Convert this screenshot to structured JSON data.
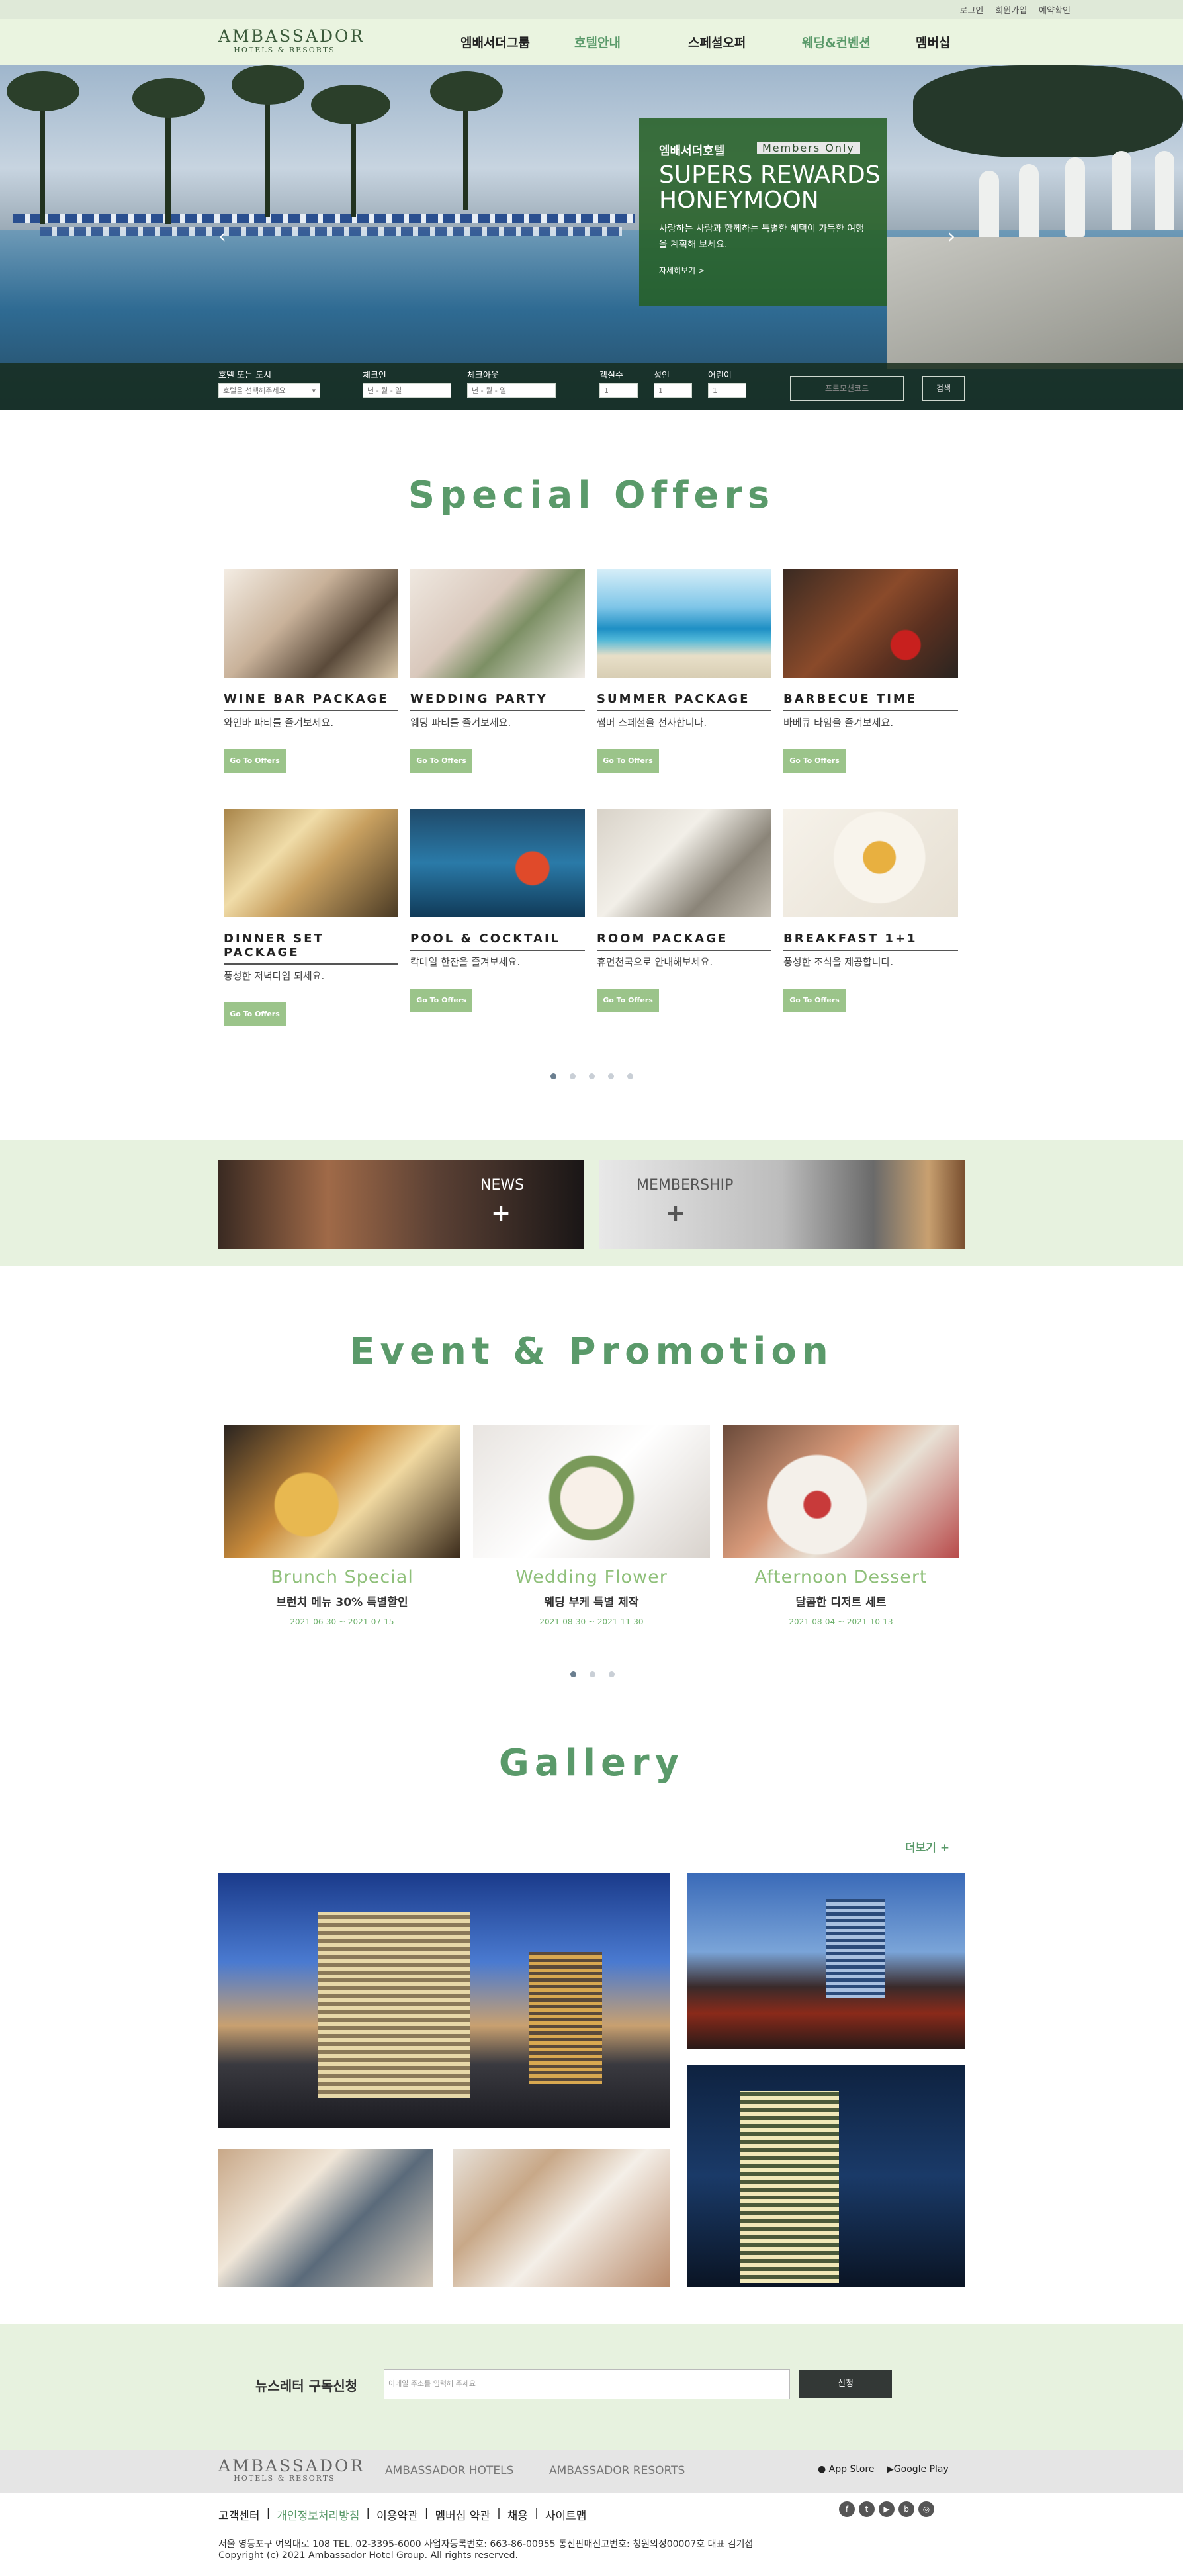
{
  "top_links": [
    "로그인",
    "회원가입",
    "예약확인"
  ],
  "logo": {
    "line1": "AMBASSADOR",
    "line2": "HOTELS & RESORTS"
  },
  "nav": [
    "엠배서더그룹",
    "호텔안내",
    "스페셜오퍼",
    "웨딩&컨벤션",
    "멤버십"
  ],
  "hero": {
    "promo_title": "엠배서더호텔",
    "promo_badge": "Members Only",
    "promo_heading": "SUPERS REWARDS HONEYMOON",
    "promo_text": "사랑하는 사람과 함께하는 특별한 혜택이 가득한 여행을 계획해 보세요.",
    "promo_link": "자세히보기 >",
    "prev_arrow": "‹",
    "next_arrow": "›"
  },
  "search": {
    "hotel_label": "호텔 또는 도시",
    "hotel_value": "호텔을 선택해주세요",
    "checkin_label": "체크인",
    "checkin_value": "년 - 월 - 일",
    "checkout_label": "체크아웃",
    "checkout_value": "년 - 월 - 일",
    "rooms_label": "객실수",
    "rooms_value": "1",
    "adult_label": "성인",
    "adult_value": "1",
    "child_label": "어린이",
    "child_value": "1",
    "promo_placeholder": "프로모션코드",
    "search_button": "검색"
  },
  "special_offers": {
    "title": "Special Offers",
    "items": [
      {
        "name": "WINE BAR PACKAGE",
        "desc": "와인바 파티를 즐겨보세요.",
        "button": "Go To Offers"
      },
      {
        "name": "WEDDING PARTY",
        "desc": "웨딩 파티를 즐겨보세요.",
        "button": "Go To Offers"
      },
      {
        "name": "SUMMER PACKAGE",
        "desc": "썸머 스페셜을 선사합니다.",
        "button": "Go To Offers"
      },
      {
        "name": "BARBECUE TIME",
        "desc": "바베큐 타임을 즐겨보세요.",
        "button": "Go To Offers"
      },
      {
        "name": "DINNER SET PACKAGE",
        "desc": "풍성한 저녁타임 되세요.",
        "button": "Go To Offers"
      },
      {
        "name": "POOL & COCKTAIL",
        "desc": "칵테일 한잔을 즐겨보세요.",
        "button": "Go To Offers"
      },
      {
        "name": "ROOM PACKAGE",
        "desc": "휴먼천국으로 안내해보세요.",
        "button": "Go To Offers"
      },
      {
        "name": "BREAKFAST 1+1",
        "desc": "풍성한 조식을 제공합니다.",
        "button": "Go To Offers"
      }
    ],
    "pager_count": 5,
    "pager_active": 1
  },
  "banners": {
    "news_label": "NEWS",
    "membership_label": "MEMBERSHIP",
    "plus": "+"
  },
  "events": {
    "title": "Event & Promotion",
    "items": [
      {
        "title": "Brunch Special",
        "subtitle": "브런치 메뉴 30% 특별할인",
        "date": "2021-06-30 ~ 2021-07-15"
      },
      {
        "title": "Wedding Flower",
        "subtitle": "웨딩 부케 특별 제작",
        "date": "2021-08-30 ~ 2021-11-30"
      },
      {
        "title": "Afternoon Dessert",
        "subtitle": "달콤한 디저트 세트",
        "date": "2021-08-04 ~ 2021-10-13"
      }
    ],
    "pager_count": 3,
    "pager_active": 1
  },
  "gallery": {
    "title": "Gallery",
    "more": "더보기  +"
  },
  "newsletter": {
    "label": "뉴스레터 구독신청",
    "placeholder": "이메일 주소를 입력해 주세요",
    "button": "신청"
  },
  "footer": {
    "logo_line1": "AMBASSADOR",
    "logo_line2": "HOTELS & RESORTS",
    "link1": "AMBASSADOR HOTELS",
    "link2": "AMBASSADOR RESORTS",
    "app_store": "App Store",
    "google_play": "Google Play",
    "links": [
      "고객센터",
      "개인정보처리방침",
      "이용약관",
      "멤버십 약관",
      "채용",
      "사이트맵"
    ],
    "address": "서울 영등포구 여의대로 108 TEL. 02-3395-6000 사업자등록번호: 663-86-00955 통신판매신고번호: 청원의정00007호 대표 김기섭",
    "copyright": "Copyright (c) 2021 Ambassador Hotel Group. All rights reserved.",
    "social_icons": [
      "facebook-icon",
      "twitter-icon",
      "youtube-icon",
      "blog-icon",
      "instagram-icon"
    ]
  },
  "colors": {
    "accent_green": "#5a9a6a",
    "button_green": "#9bc48a",
    "band_green": "#e7f2df"
  }
}
